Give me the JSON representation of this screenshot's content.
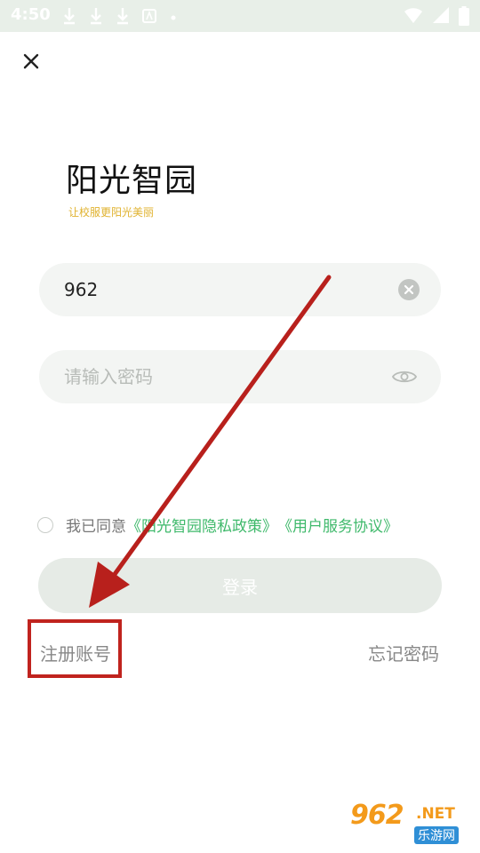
{
  "status_bar": {
    "time": "4:50"
  },
  "app": {
    "title": "阳光智园",
    "slogan": "让校服更阳光美丽"
  },
  "account_field": {
    "value": "962"
  },
  "password_field": {
    "placeholder": "请输入密码",
    "value": ""
  },
  "agreement": {
    "prefix": "我已同意",
    "privacy_link": "《阳光智园隐私政策》",
    "service_link": "《用户服务协议》"
  },
  "login_button": {
    "label": "登录"
  },
  "register_link": {
    "label": "注册账号"
  },
  "forgot_link": {
    "label": "忘记密码"
  },
  "watermark": {
    "brand": "962",
    "suffix": ".NET",
    "site": "乐游网"
  },
  "colors": {
    "slogan": "#e0b22e",
    "link": "#3fb96b",
    "annotation": "#c0231e"
  },
  "icons": [
    "close-icon",
    "clear-icon",
    "eye-icon",
    "download-icon",
    "wifi-icon",
    "signal-icon",
    "battery-icon"
  ]
}
